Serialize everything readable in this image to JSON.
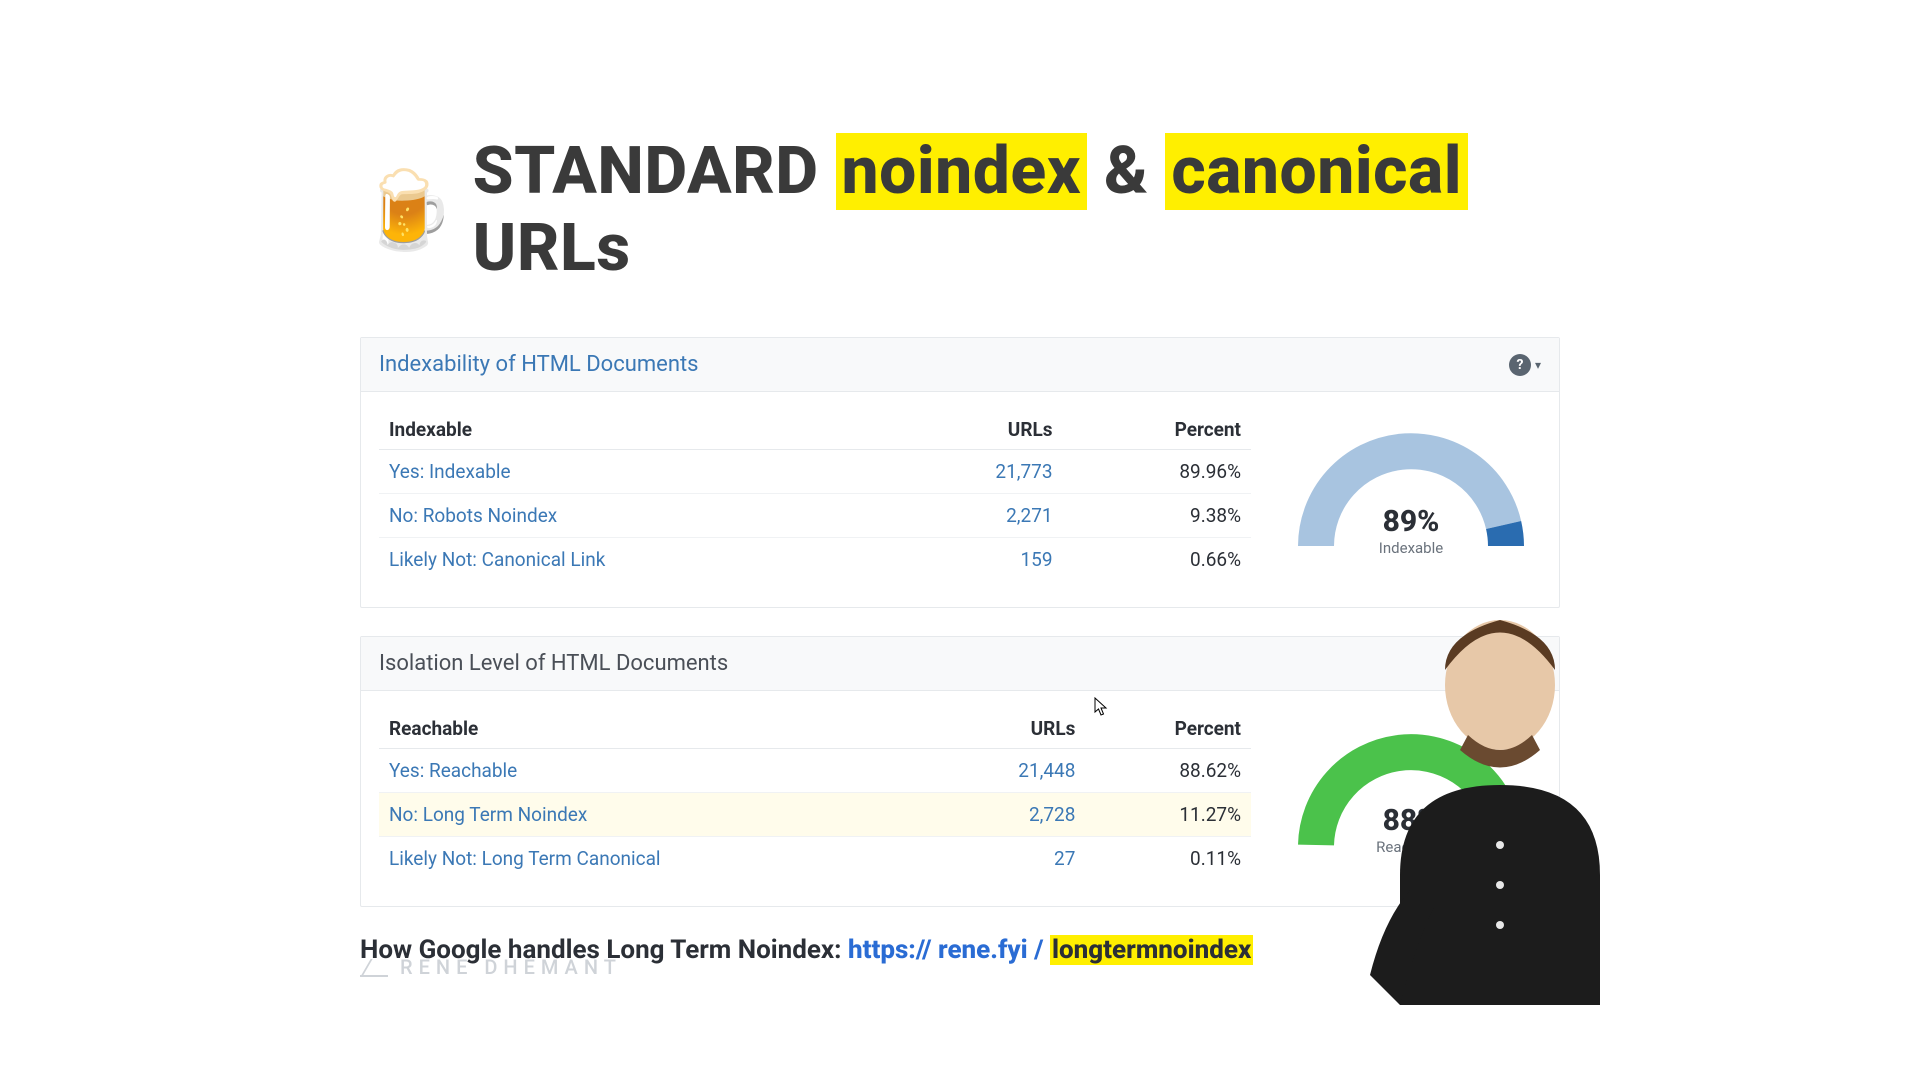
{
  "title": {
    "icon": "🍺",
    "t1": "STANDARD",
    "t2": "noindex",
    "t3": "&",
    "t4": "canonical",
    "t5": "URLs"
  },
  "panels": {
    "indexability": {
      "header": "Indexability of HTML Documents",
      "columns": {
        "c1": "Indexable",
        "c2": "URLs",
        "c3": "Percent"
      },
      "rows": [
        {
          "label": "Yes: Indexable",
          "urls": "21,773",
          "pct": "89.96%"
        },
        {
          "label": "No: Robots Noindex",
          "urls": "2,271",
          "pct": "9.38%"
        },
        {
          "label": "Likely Not: Canonical Link",
          "urls": "159",
          "pct": "0.66%"
        }
      ],
      "gauge": {
        "pct": "89%",
        "sub": "Indexable"
      }
    },
    "isolation": {
      "header": "Isolation Level of HTML Documents",
      "columns": {
        "c1": "Reachable",
        "c2": "URLs",
        "c3": "Percent"
      },
      "rows": [
        {
          "label": "Yes: Reachable",
          "urls": "21,448",
          "pct": "88.62%"
        },
        {
          "label": "No: Long Term Noindex",
          "urls": "2,728",
          "pct": "11.27%"
        },
        {
          "label": "Likely Not: Long Term Canonical",
          "urls": "27",
          "pct": "0.11%"
        }
      ],
      "gauge": {
        "pct": "88%",
        "sub": "Reachable"
      }
    }
  },
  "footer": {
    "lead": "How Google handles Long Term Noindex:",
    "url_prefix": "https:// rene.fyi /",
    "url_slug": "longtermnoindex"
  },
  "watermark": "RENE DHEMANT",
  "chart_data": [
    {
      "type": "pie",
      "title": "Indexability of HTML Documents",
      "categories": [
        "Yes: Indexable",
        "No: Robots Noindex",
        "Likely Not: Canonical Link"
      ],
      "values": [
        89.96,
        9.38,
        0.66
      ],
      "gauge_center_value": 89,
      "gauge_center_label": "Indexable"
    },
    {
      "type": "pie",
      "title": "Isolation Level of HTML Documents",
      "categories": [
        "Yes: Reachable",
        "No: Long Term Noindex",
        "Likely Not: Long Term Canonical"
      ],
      "values": [
        88.62,
        11.27,
        0.11
      ],
      "gauge_center_value": 88,
      "gauge_center_label": "Reachable"
    }
  ]
}
